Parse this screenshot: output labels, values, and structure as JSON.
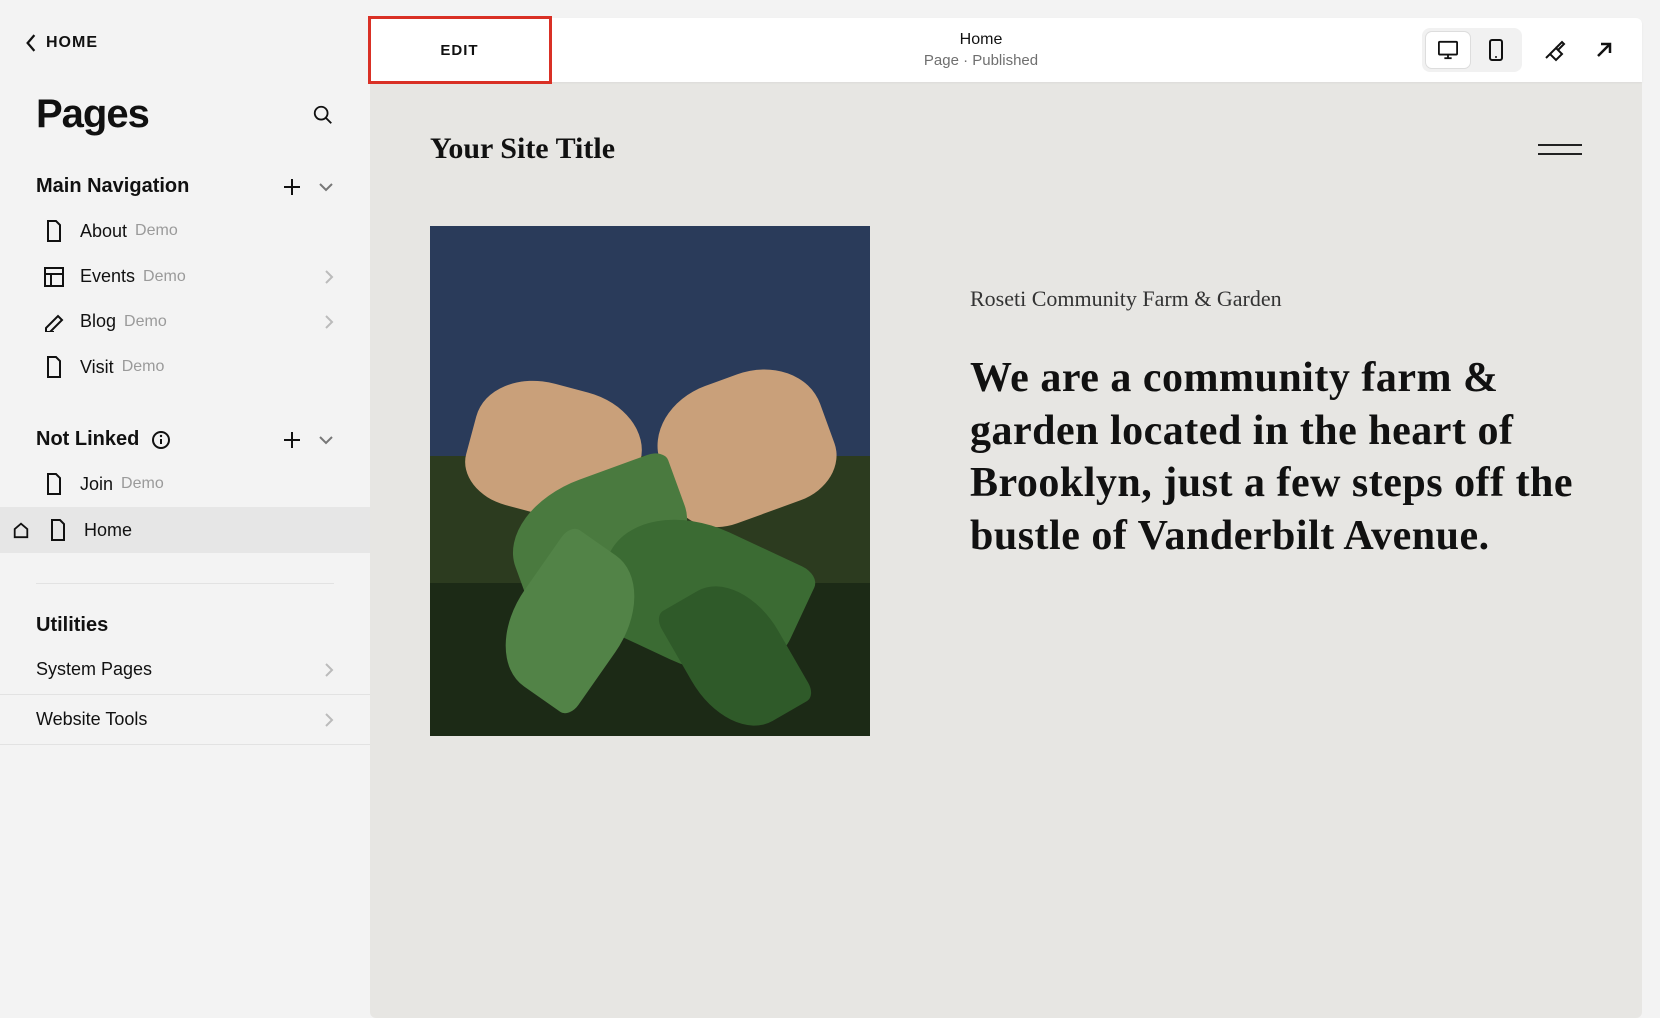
{
  "sidebar": {
    "back_label": "HOME",
    "title": "Pages",
    "sections": {
      "main_nav": {
        "label": "Main Navigation",
        "items": [
          {
            "name": "About",
            "demo": "Demo",
            "icon": "page",
            "has_children": false
          },
          {
            "name": "Events",
            "demo": "Demo",
            "icon": "layout",
            "has_children": true
          },
          {
            "name": "Blog",
            "demo": "Demo",
            "icon": "blog",
            "has_children": true
          },
          {
            "name": "Visit",
            "demo": "Demo",
            "icon": "page",
            "has_children": false
          }
        ]
      },
      "not_linked": {
        "label": "Not Linked",
        "items": [
          {
            "name": "Join",
            "demo": "Demo",
            "icon": "page",
            "is_home": false,
            "active": false
          },
          {
            "name": "Home",
            "demo": "",
            "icon": "page",
            "is_home": true,
            "active": true
          }
        ]
      }
    },
    "utilities": {
      "label": "Utilities",
      "items": [
        {
          "name": "System Pages"
        },
        {
          "name": "Website Tools"
        }
      ]
    }
  },
  "topbar": {
    "edit_label": "EDIT",
    "page_title": "Home",
    "page_meta": "Page · Published",
    "device": {
      "desktop_active": true,
      "mobile_active": false
    }
  },
  "preview": {
    "site_title": "Your Site Title",
    "hero_eyebrow": "Roseti Community Farm & Garden",
    "hero_heading": "We are a community farm & garden located in the heart of Brooklyn, just a few steps off the bustle of Vanderbilt Avenue."
  },
  "annotations": {
    "edit_highlighted": true
  }
}
